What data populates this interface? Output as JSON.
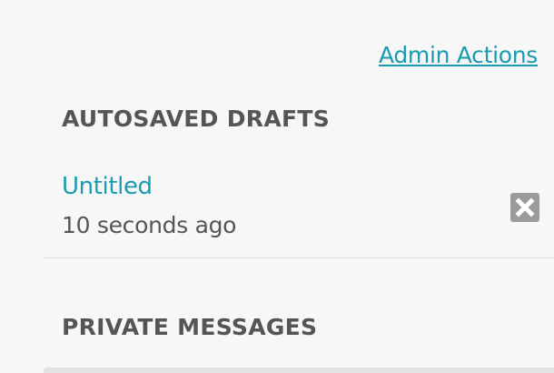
{
  "header": {
    "admin_actions_label": "Admin Actions"
  },
  "drafts": {
    "heading": "AUTOSAVED DRAFTS",
    "items": [
      {
        "title": "Untitled",
        "time": "10 seconds ago",
        "delete_icon": "close-icon"
      }
    ]
  },
  "messages": {
    "heading": "PRIVATE MESSAGES"
  },
  "colors": {
    "link": "#1a9bb0",
    "heading": "#555555",
    "background": "#f7f7f7",
    "delete_button": "#9a9a9a"
  }
}
